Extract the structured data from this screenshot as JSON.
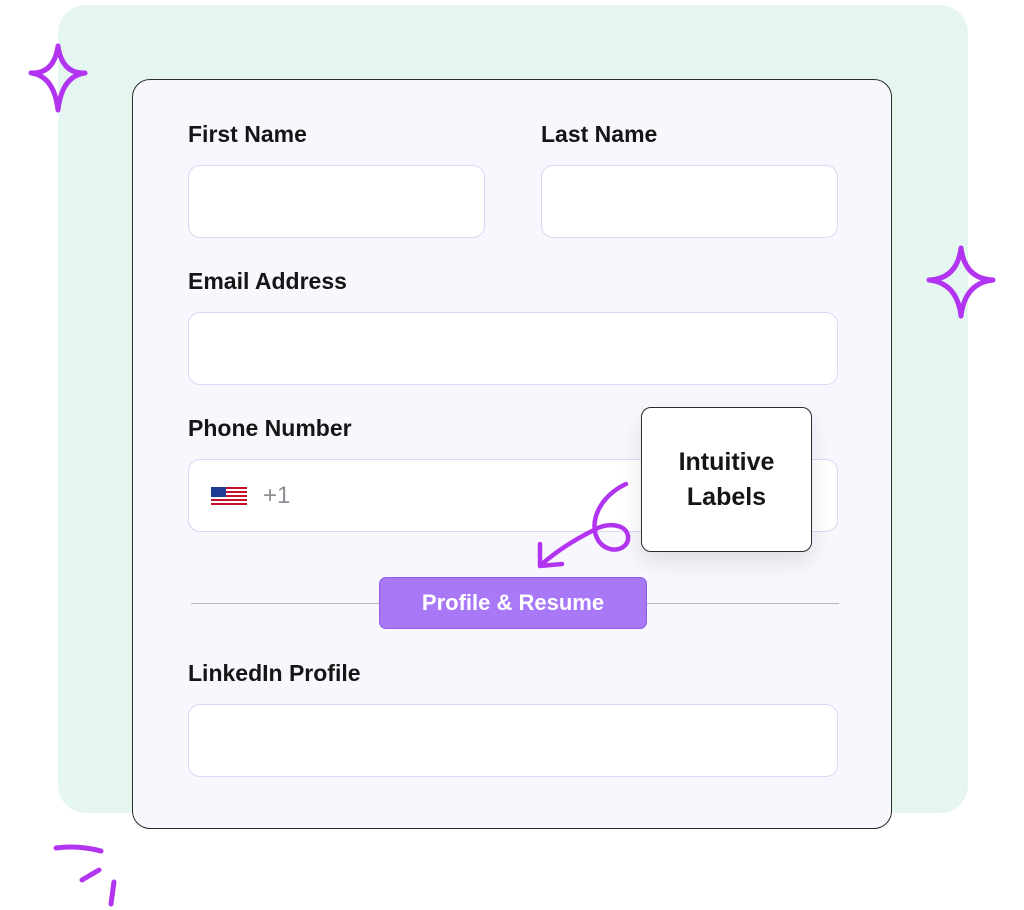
{
  "form": {
    "first_name_label": "First Name",
    "last_name_label": "Last Name",
    "email_label": "Email Address",
    "phone_label": "Phone Number",
    "phone_country": "us-flag-icon",
    "phone_dial_code": "+1",
    "section_label": "Profile & Resume",
    "linkedin_label": "LinkedIn Profile",
    "first_name_value": "",
    "last_name_value": "",
    "email_value": "",
    "phone_value": "",
    "linkedin_value": ""
  },
  "callout": {
    "line1": "Intuitive",
    "line2": "Labels"
  },
  "colors": {
    "background_panel": "#e5f6f1",
    "card": "#f8f7fd",
    "accent_purple": "#a878f6",
    "sparkle": "#b234f0",
    "input_border": "#dcd6f5"
  },
  "decorations": [
    "sparkle-icon",
    "sparkle-icon",
    "squiggle-arrow-icon",
    "scribble-marks-icon"
  ]
}
